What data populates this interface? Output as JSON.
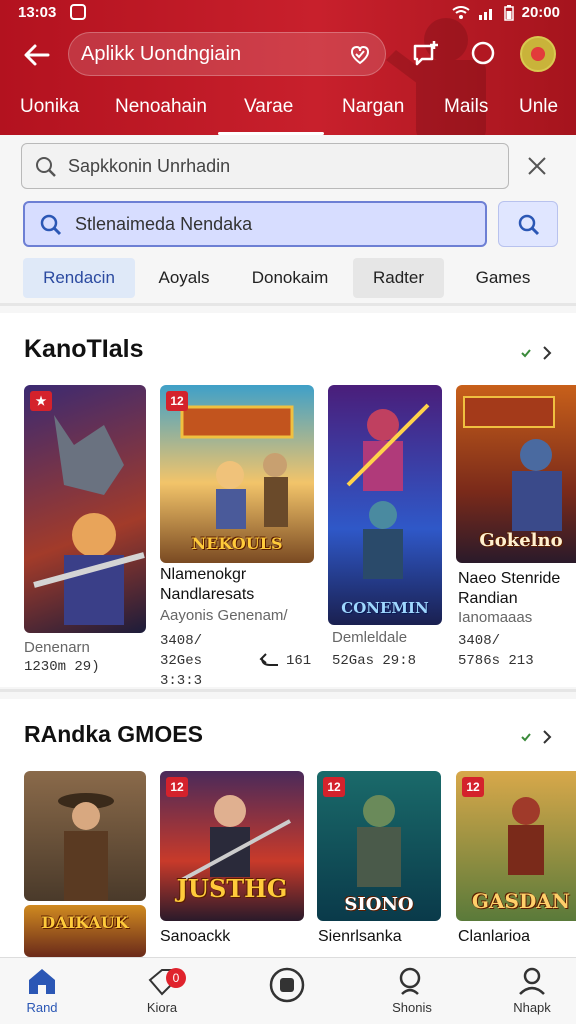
{
  "status_bar": {
    "time": "13:03",
    "clock_right": "20:00"
  },
  "header": {
    "title": "Aplikk Uondngiain",
    "tabs": [
      "Uonika",
      "Nenoahain",
      "Varae",
      "Nargan",
      "Mails",
      "Unle"
    ],
    "active_tab": 2
  },
  "search": {
    "primary_value": "Sapkkonin Unrhadin",
    "secondary_value": "Stlenaimeda Nendaka"
  },
  "chips": [
    "Rendacin",
    "Aoyals",
    "Donokaim",
    "Radter",
    "Games"
  ],
  "section1": {
    "title": "KanoTIals",
    "cards": [
      {
        "badge": "",
        "title": "",
        "sub": "Denenarn",
        "meta": "1230m 29)",
        "overlay": ""
      },
      {
        "badge": "12",
        "title": "Nlamenokgr Nandlaresats",
        "sub": "Aayonis Genenam/",
        "meta": "3408/ 32Ges 3:3:3",
        "extra": "161",
        "overlay": "NEKOULS"
      },
      {
        "badge": "",
        "title": "",
        "sub": "Demleldale",
        "meta": "52Gas 29:8",
        "overlay": "CONEMIN"
      },
      {
        "badge": "",
        "title": "Naeo Stenride Randian",
        "sub": "Ianomaaas",
        "meta": "3408/ 5786s 213",
        "overlay": "Gokelno"
      }
    ]
  },
  "section2": {
    "title": "RAndka GMOES",
    "cards": [
      {
        "badge": "",
        "title": "",
        "overlay": "DAIKAUK"
      },
      {
        "badge": "12",
        "title": "Sanoackk",
        "overlay": "JUSTHG"
      },
      {
        "badge": "12",
        "title": "Sienrlsanka",
        "overlay": "SIONO"
      },
      {
        "badge": "12",
        "title": "Clanlarioa",
        "overlay": "GASDAN"
      }
    ]
  },
  "bottom_nav": [
    {
      "label": "Rand",
      "icon": "home-icon"
    },
    {
      "label": "Kiora",
      "icon": "tag-icon",
      "badge": "0"
    },
    {
      "label": "",
      "icon": "center-circle-icon"
    },
    {
      "label": "Shonis",
      "icon": "search-icon"
    },
    {
      "label": "Nhapk",
      "icon": "profile-icon"
    }
  ],
  "colors": {
    "header_red": "#c8202c",
    "accent_blue": "#2b57b5",
    "search_blue_bg": "#d7ddff"
  }
}
